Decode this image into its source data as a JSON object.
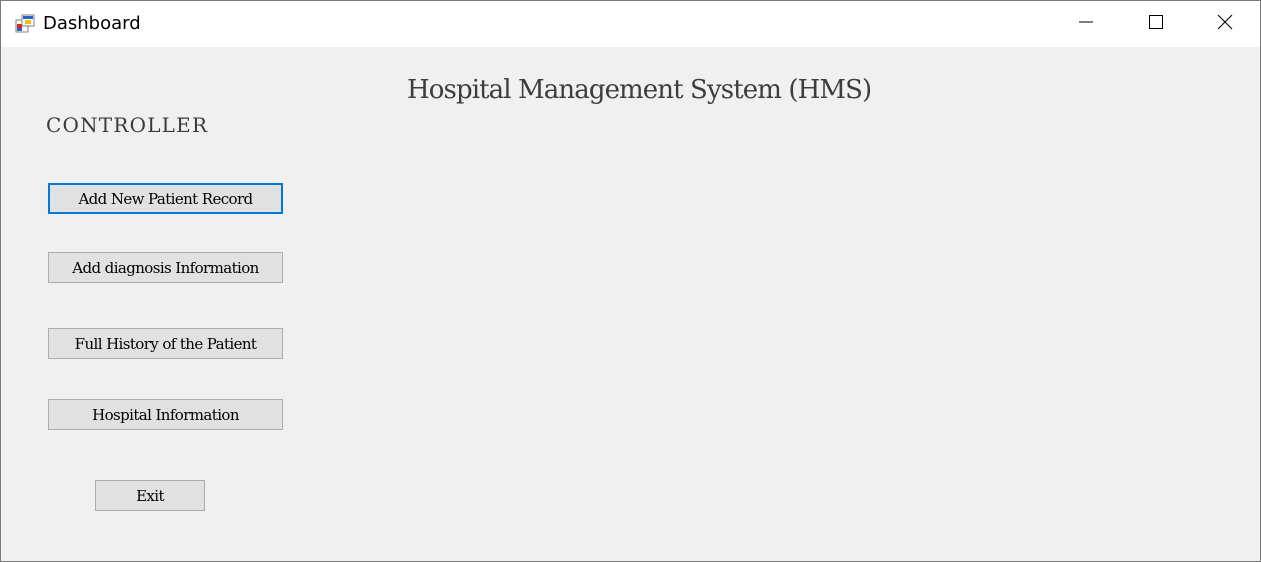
{
  "window": {
    "title": "Dashboard",
    "icon": "app-form-icon",
    "controls": {
      "minimize_icon": "minimize-icon",
      "maximize_icon": "maximize-icon",
      "close_icon": "close-icon"
    }
  },
  "main": {
    "app_title": "Hospital Management System (HMS)",
    "section_label": "CONTROLLER",
    "buttons": [
      {
        "label": "Add New Patient Record",
        "focused": true
      },
      {
        "label": "Add diagnosis Information",
        "focused": false
      },
      {
        "label": "Full History of the Patient",
        "focused": false
      },
      {
        "label": "Hospital Information",
        "focused": false
      },
      {
        "label": "Exit",
        "focused": false
      }
    ]
  },
  "colors": {
    "focus_border": "#0078d7",
    "button_face": "#e1e1e1",
    "client_background": "#f0f0f0"
  }
}
